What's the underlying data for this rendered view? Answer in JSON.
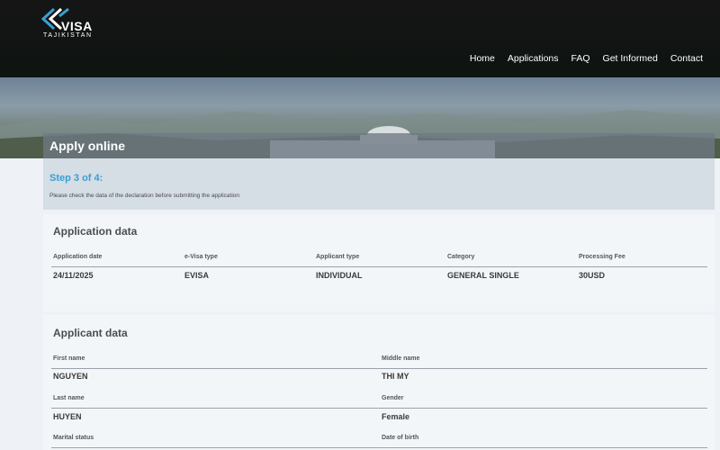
{
  "header": {
    "logo_text": "VISA",
    "logo_country": "TAJIKISTAN",
    "nav": [
      "Home",
      "Applications",
      "FAQ",
      "Get Informed",
      "Contact"
    ]
  },
  "page": {
    "title": "Apply online",
    "step_title": "Step 3 of 4:",
    "step_desc": "Please check the data of the declaration before submitting the application"
  },
  "application": {
    "title": "Application data",
    "headers": [
      "Application date",
      "e-Visa type",
      "Applicant type",
      "Category",
      "Processing Fee"
    ],
    "values": [
      "24/11/2025",
      "EVISA",
      "INDIVIDUAL",
      "GENERAL SINGLE",
      "30USD"
    ]
  },
  "applicant": {
    "title": "Applicant data",
    "first_name_label": "First name",
    "first_name": "NGUYEN",
    "middle_name_label": "Middle name",
    "middle_name": "THI MY",
    "last_name_label": "Last name",
    "last_name": "HUYEN",
    "gender_label": "Gender",
    "gender": "Female",
    "marital_label": "Marital status",
    "dob_label": "Date of birth"
  },
  "colors": {
    "header_bg": "#151515",
    "accent": "#3b9fd1",
    "title_bar": "#6e7884",
    "step_bg": "#d5dde5"
  }
}
